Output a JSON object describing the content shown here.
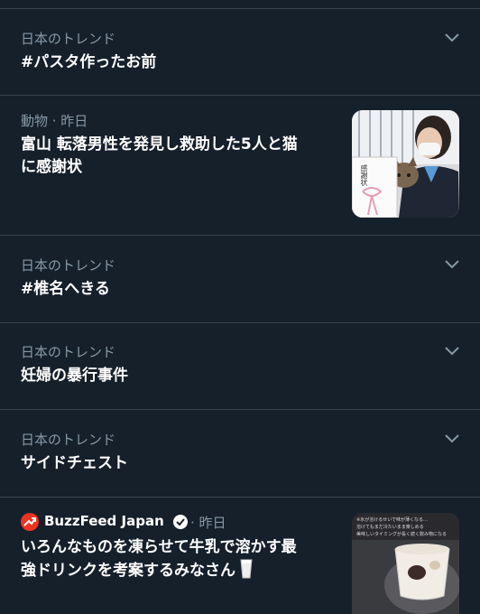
{
  "trends": [
    {
      "meta": "日本のトレンド",
      "title": "#パスタ作ったお前"
    },
    {
      "meta": "動物 · 昨日",
      "title_line1": "富山 転落男性を発見し救助した5人と猫",
      "title_line2": "に感謝状"
    },
    {
      "meta": "日本のトレンド",
      "title": "#椎名へきる"
    },
    {
      "meta": "日本のトレンド",
      "title": "妊婦の暴行事件"
    },
    {
      "meta": "日本のトレンド",
      "title": "サイドチェスト"
    },
    {
      "source": "BuzzFeed Japan",
      "time": "· 昨日",
      "title_line1": "いろんなものを凍らせて牛乳で溶かす最",
      "title_line2": "強ドリンクを考案するみなさん"
    }
  ],
  "thumbnail_texts": {
    "cat_sign": "感謝状",
    "drink_caption_line1": "※氷が溶けるせいで味が薄くなる…",
    "drink_caption_line2": "溶けてもまだ冷たいまま楽しめる",
    "drink_caption_line3": "美味しいタイミングが長く続く飲み物になる"
  },
  "colors": {
    "background": "#15202b",
    "divider": "#38444d",
    "secondary_text": "#8899a6",
    "primary_text": "#ffffff",
    "buzzfeed_red": "#ee3322"
  },
  "icons": {
    "chevron": "chevron-down-icon",
    "verified": "verified-badge-icon",
    "buzzfeed": "buzzfeed-logo-icon",
    "milk": "milk-glass-emoji"
  }
}
